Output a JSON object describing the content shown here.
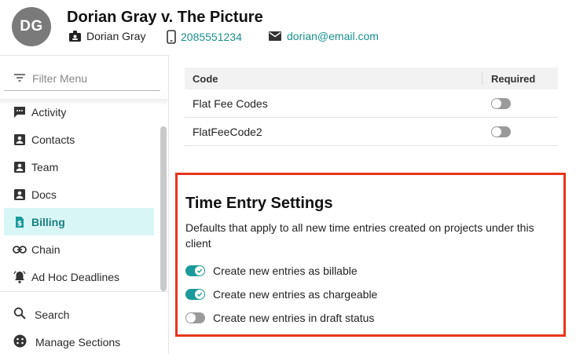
{
  "client": {
    "initials": "DG",
    "title": "Dorian Gray v. The Picture",
    "contact_name": "Dorian Gray",
    "phone": "2085551234",
    "email": "dorian@email.com"
  },
  "sidebar": {
    "filter_placeholder": "Filter Menu",
    "items": [
      {
        "label": "Activity",
        "icon": "chat-icon"
      },
      {
        "label": "Contacts",
        "icon": "contact-card-icon"
      },
      {
        "label": "Team",
        "icon": "contact-card-icon"
      },
      {
        "label": "Docs",
        "icon": "contact-card-icon"
      },
      {
        "label": "Billing",
        "icon": "dollar-icon",
        "active": true
      },
      {
        "label": "Chain",
        "icon": "link-icon"
      },
      {
        "label": "Ad Hoc Deadlines",
        "icon": "bell-icon"
      }
    ],
    "bottom": [
      {
        "label": "Search",
        "icon": "search-icon"
      },
      {
        "label": "Manage Sections",
        "icon": "grid-dots-icon"
      }
    ]
  },
  "codes_table": {
    "columns": [
      "Code",
      "Required"
    ],
    "rows": [
      {
        "code": "Flat Fee Codes",
        "required": false
      },
      {
        "code": "FlatFeeCode2",
        "required": false
      }
    ]
  },
  "time_entry_settings": {
    "title": "Time Entry Settings",
    "description": "Defaults that apply to all new time entries created on projects under this client",
    "options": [
      {
        "label": "Create new entries as billable",
        "enabled": true
      },
      {
        "label": "Create new entries as chargeable",
        "enabled": true
      },
      {
        "label": "Create new entries in draft status",
        "enabled": false
      }
    ]
  },
  "colors": {
    "accent": "#1a9a9a",
    "link": "#1a8f8f",
    "active_bg": "#d9f6f6",
    "highlight_border": "#e8361c",
    "avatar_bg": "#7a7a7a"
  }
}
